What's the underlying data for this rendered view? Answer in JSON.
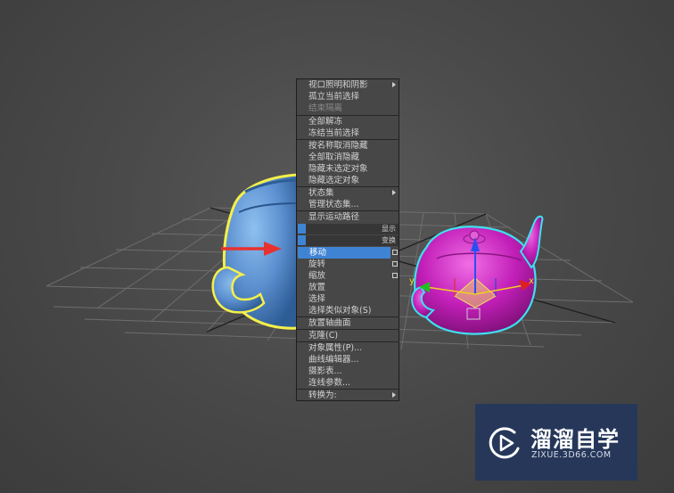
{
  "quad_menu": {
    "items": [
      {
        "label": "视口照明和阴影",
        "state": "normal",
        "submenu": true
      },
      {
        "label": "孤立当前选择",
        "state": "normal"
      },
      {
        "label": "结束隔离",
        "state": "disabled"
      },
      {
        "label": "全部解冻",
        "state": "normal"
      },
      {
        "label": "冻结当前选择",
        "state": "normal"
      },
      {
        "label": "按名称取消隐藏",
        "state": "normal"
      },
      {
        "label": "全部取消隐藏",
        "state": "normal"
      },
      {
        "label": "隐藏未选定对象",
        "state": "normal"
      },
      {
        "label": "隐藏选定对象",
        "state": "normal"
      },
      {
        "label": "状态集",
        "state": "normal",
        "submenu": true
      },
      {
        "label": "管理状态集...",
        "state": "normal"
      },
      {
        "label": "显示运动路径",
        "state": "normal"
      },
      {
        "label": "移动",
        "state": "highlighted",
        "option_box": true
      },
      {
        "label": "旋转",
        "state": "normal",
        "option_box": true
      },
      {
        "label": "缩放",
        "state": "normal",
        "option_box": true
      },
      {
        "label": "放置",
        "state": "normal"
      },
      {
        "label": "选择",
        "state": "normal"
      },
      {
        "label": "选择类似对象(S)",
        "state": "normal"
      },
      {
        "label": "放置轴曲面",
        "state": "normal"
      },
      {
        "label": "克隆(C)",
        "state": "normal"
      },
      {
        "label": "对象属性(P)...",
        "state": "normal"
      },
      {
        "label": "曲线编辑器...",
        "state": "normal"
      },
      {
        "label": "摄影表...",
        "state": "normal"
      },
      {
        "label": "连线参数...",
        "state": "normal"
      },
      {
        "label": "转换为:",
        "state": "normal",
        "submenu": true
      }
    ],
    "quadrant_labels": {
      "display": "显示",
      "transform": "变换"
    }
  },
  "gizmo": {
    "axis_x": "x",
    "axis_y": "y"
  },
  "watermark": {
    "name": "溜溜自学",
    "url": "ZIXUE.3D66.COM"
  },
  "colors": {
    "viewport_bg": "#4a4a4a",
    "grid": "#7a7a7a",
    "teapot_blue": "#5b8fcf",
    "teapot_magenta": "#c21fb8",
    "selection_yellow": "#f4f04a",
    "selection_cyan": "#3fe0f0",
    "menu_bg": "#474747",
    "menu_highlight": "#3f84d4",
    "watermark_bg": "#26375a",
    "pointer_arrow": "#e8322f"
  },
  "icons": [
    "play-circle-logo-icon",
    "submenu-arrow-icon",
    "option-box-icon",
    "red-pointer-arrow-icon",
    "transform-gizmo-icon"
  ]
}
